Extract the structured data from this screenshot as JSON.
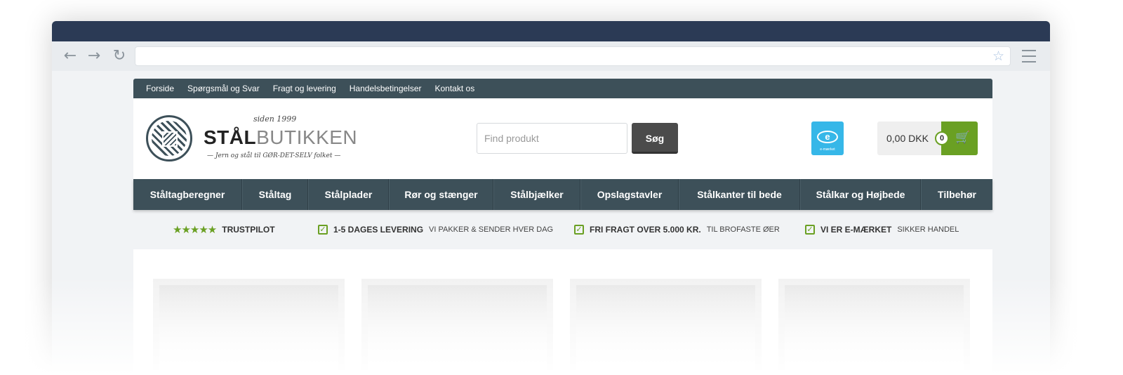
{
  "browser": {
    "back_icon": "arrow-left-icon",
    "forward_icon": "arrow-right-icon",
    "reload_icon": "reload-icon",
    "bookmark_icon": "star-icon",
    "menu_icon": "hamburger-icon",
    "address": ""
  },
  "topbar": {
    "links": [
      "Forside",
      "Spørgsmål og Svar",
      "Fragt og levering",
      "Handelsbetingelser",
      "Kontakt os"
    ]
  },
  "header": {
    "since": "siden 1999",
    "brand_bold": "STÅL",
    "brand_light": "BUTIKKEN",
    "tagline": "— Jern og stål til GØR-DET-SELV folket —",
    "search_placeholder": "Find produkt",
    "search_button": "Søg",
    "emark_caption": "e-mærket",
    "cart_total": "0,00 DKK",
    "cart_count": "0"
  },
  "mainnav": {
    "items": [
      "Ståltagberegner",
      "Ståltag",
      "Stålplader",
      "Rør og stænger",
      "Stålbjælker",
      "Opslagstavler",
      "Stålkanter til bede",
      "Stålkar og Højbede",
      "Tilbehør"
    ]
  },
  "usp": {
    "trustpilot_stars": "★★★★★",
    "trustpilot_label": "TRUSTPILOT",
    "delivery_strong": "1-5 DAGES LEVERING",
    "delivery_small": "VI PAKKER & SENDER HVER DAG",
    "freight_strong": "FRI FRAGT OVER 5.000 KR.",
    "freight_small": "TIL BROFASTE ØER",
    "emark_strong": "VI ER E-MÆRKET",
    "emark_small": "SIKKER HANDEL"
  },
  "colors": {
    "titlebar": "#2b3a55",
    "nav": "#3d5059",
    "accent_green": "#6aa023",
    "emark_blue": "#36b7e8"
  }
}
